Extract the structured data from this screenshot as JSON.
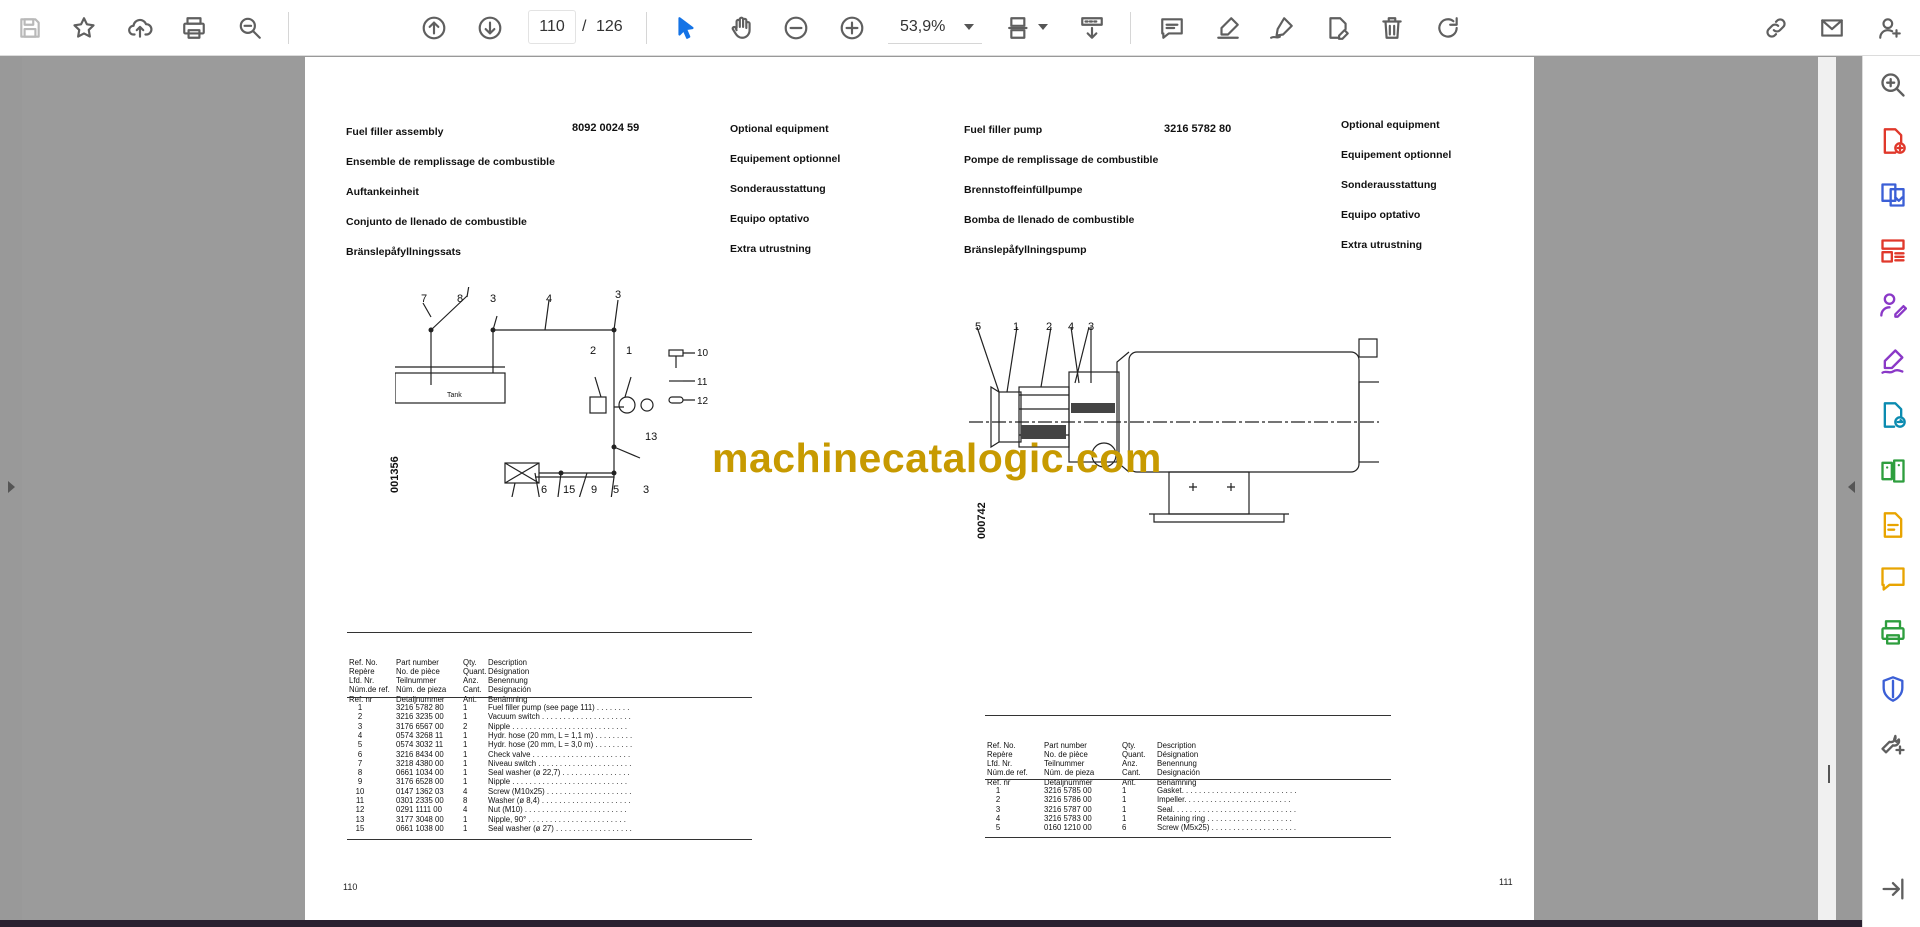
{
  "toolbar": {
    "current_page": "110",
    "page_separator": "/",
    "total_pages": "126",
    "zoom": "53,9%"
  },
  "watermark": "machinecatalogic.com",
  "left_page": {
    "title_lines": [
      "Fuel filler assembly",
      "Ensemble de remplissage de combustible",
      "Auftankeinheit",
      "Conjunto de llenado de combustible",
      "Bränslepåfyllningssats"
    ],
    "part_number": "8092 0024 59",
    "category_lines": [
      "Optional equipment",
      "Equipement optionnel",
      "Sonderausstattung",
      "Equipo optativo",
      "Extra utrustning"
    ],
    "figure_code": "001356",
    "figure_labels": {
      "tank": "Tank",
      "top": [
        "7",
        "8",
        "3",
        "4",
        "3"
      ],
      "mid": [
        "2",
        "1",
        "13"
      ],
      "bottom": [
        "6",
        "15",
        "9",
        "5",
        "3"
      ],
      "small_parts": [
        "10",
        "11",
        "12"
      ]
    },
    "table_header": {
      "ref": [
        "Ref. No.",
        "Repère",
        "Lfd. Nr.",
        "Núm.de ref.",
        "Ref. nr"
      ],
      "part": [
        "Part number",
        "No. de pièce",
        "Teilnummer",
        "Núm. de pieza",
        "Detaljnummer"
      ],
      "qty": [
        "Qty.",
        "Quant.",
        "Anz.",
        "Cant.",
        "Ant."
      ],
      "desc": [
        "Description",
        "Désignation",
        "Benennung",
        "Designación",
        "Benämning"
      ]
    },
    "rows": [
      {
        "ref": "1",
        "part": "3216 5782 80",
        "qty": "1",
        "desc": "Fuel filler pump (see page 111) . . . . . . . ."
      },
      {
        "ref": "2",
        "part": "3216 3235 00",
        "qty": "1",
        "desc": "Vacuum switch . . . . . . . . . . . . . . . . . . . . ."
      },
      {
        "ref": "3",
        "part": "3176 6567 00",
        "qty": "2",
        "desc": "Nipple . . . . . . . . . . . . . . . . . . . . . . . . . . ."
      },
      {
        "ref": "4",
        "part": "0574 3268 11",
        "qty": "1",
        "desc": "Hydr. hose (20 mm, L = 1,1 m) . . . . . . . . ."
      },
      {
        "ref": "5",
        "part": "0574 3032 11",
        "qty": "1",
        "desc": "Hydr. hose (20 mm, L = 3,0 m) . . . . . . . . ."
      },
      {
        "ref": "6",
        "part": "3216 8434 00",
        "qty": "1",
        "desc": "Check valve . . . . . . . . . . . . . . . . . . . . . . ."
      },
      {
        "ref": "7",
        "part": "3218 4380 00",
        "qty": "1",
        "desc": "Niveau switch . . . . . . . . . . . . . . . . . . . . . ."
      },
      {
        "ref": "8",
        "part": "0661 1034 00",
        "qty": "1",
        "desc": "Seal washer (ø 22,7) . . . . . . . . . . . . . . . ."
      },
      {
        "ref": "9",
        "part": "3176 6528 00",
        "qty": "1",
        "desc": "Nipple . . . . . . . . . . . . . . . . . . . . . . . . . . ."
      },
      {
        "ref": "10",
        "part": "0147 1362 03",
        "qty": "4",
        "desc": "Screw (M10x25) . . . . . . . . . . . . . . . . . . . ."
      },
      {
        "ref": "11",
        "part": "0301 2335 00",
        "qty": "8",
        "desc": "Washer (ø 8,4) . . . . . . . . . . . . . . . . . . . . ."
      },
      {
        "ref": "12",
        "part": "0291 1111 00",
        "qty": "4",
        "desc": "Nut (M10) . . . . . . . . . . . . . . . . . . . . . . . ."
      },
      {
        "ref": "13",
        "part": "3177 3048 00",
        "qty": "1",
        "desc": "Nipple, 90° . . . . . . . . . . . . . . . . . . . . . . ."
      },
      {
        "ref": "15",
        "part": "0661 1038 00",
        "qty": "1",
        "desc": "Seal washer (ø 27) . . . . . . . . . . . . . . . . . ."
      }
    ],
    "page_number": "110"
  },
  "right_page": {
    "title_lines": [
      "Fuel filler pump",
      "Pompe de remplissage de combustible",
      "Brennstoffeinfüllpumpe",
      "Bomba de llenado de combustible",
      "Bränslepåfyllningspump"
    ],
    "part_number": "3216 5782 80",
    "category_lines": [
      "Optional equipment",
      "Equipement optionnel",
      "Sonderausstattung",
      "Equipo optativo",
      "Extra utrustning"
    ],
    "figure_code": "000742",
    "figure_labels": [
      "5",
      "1",
      "2",
      "4",
      "3"
    ],
    "table_header": {
      "ref": [
        "Ref. No.",
        "Repère",
        "Lfd. Nr.",
        "Núm.de ref.",
        "Ref. nr"
      ],
      "part": [
        "Part number",
        "No. de pièce",
        "Teilnummer",
        "Núm. de pieza",
        "Detaljnummer"
      ],
      "qty": [
        "Qty.",
        "Quant.",
        "Anz.",
        "Cant.",
        "Ant."
      ],
      "desc": [
        "Description",
        "Désignation",
        "Benennung",
        "Designación",
        "Benämning"
      ]
    },
    "rows": [
      {
        "ref": "1",
        "part": "3216 5785 00",
        "qty": "1",
        "desc": "Gasket. . . . . . . . . . . . . . . . . . . . . . . . . . ."
      },
      {
        "ref": "2",
        "part": "3216 5786 00",
        "qty": "1",
        "desc": "Impeller. . . . . . . . . . . . . . . . . . . . . . . . ."
      },
      {
        "ref": "3",
        "part": "3216 5787 00",
        "qty": "1",
        "desc": "Seal. . . . . . . . . . . . . . . . . . . . . . . . . . . . ."
      },
      {
        "ref": "4",
        "part": "3216 5783 00",
        "qty": "1",
        "desc": "Retaining ring . . . . . . . . . . . . . . . . . . . ."
      },
      {
        "ref": "5",
        "part": "0160 1210 00",
        "qty": "6",
        "desc": "Screw (M5x25) . . . . . . . . . . . . . . . . . . . ."
      }
    ],
    "page_number": "111"
  },
  "icons": {
    "toolbar": [
      "save-icon",
      "bookmark-star-icon",
      "upload-cloud-icon",
      "print-icon",
      "find-icon",
      "page-up-icon",
      "page-down-icon",
      "select-arrow-icon",
      "hand-pan-icon",
      "zoom-out-icon",
      "zoom-in-icon",
      "page-layout-icon",
      "scroll-mode-icon",
      "comment-icon",
      "highlight-icon",
      "sign-pen-icon",
      "edit-pdf-icon",
      "delete-icon",
      "rotate-icon",
      "share-link-icon",
      "email-icon",
      "add-user-icon"
    ],
    "right_panel": [
      "zoom-search-icon",
      "create-pdf-icon",
      "combine-files-icon",
      "organize-pages-icon",
      "request-signatures-icon",
      "fill-sign-icon",
      "export-pdf-icon",
      "compare-files-icon",
      "edit-pdf-icon",
      "comment-icon",
      "print-production-icon",
      "protect-icon",
      "more-tools-icon",
      "expand-panel-icon"
    ]
  },
  "colors": {
    "accent_blue": "#1473e6",
    "watermark": "#c79a00",
    "tool_red": "#e0382b",
    "tool_blue": "#3b5fd6",
    "tool_purple": "#8a38c7",
    "tool_green": "#2e9e3e",
    "tool_yellow": "#e8a400",
    "tool_teal": "#0b8bb0"
  }
}
